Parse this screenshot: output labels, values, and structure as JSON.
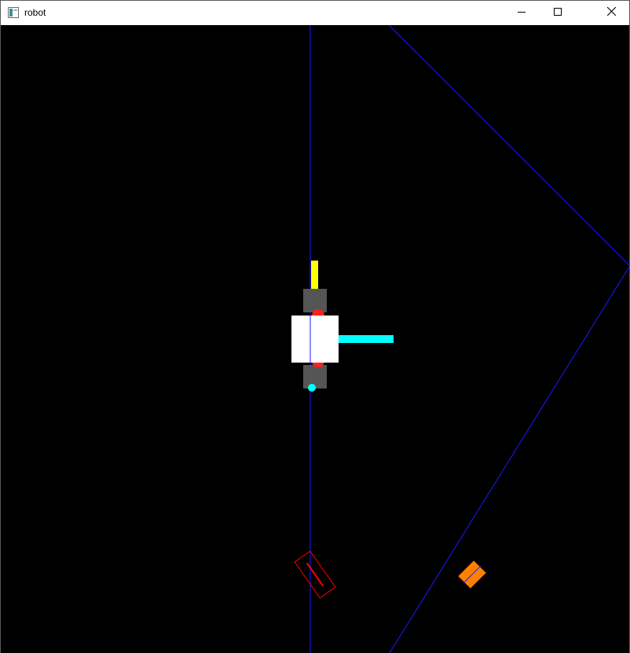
{
  "window": {
    "title": "robot",
    "icon": "app-window-icon",
    "controls": {
      "minimize_icon": "minimize-icon",
      "maximize_icon": "maximize-icon",
      "close_icon": "close-icon"
    }
  },
  "scene": {
    "background_color": "#000000",
    "guide_line_color": "#1a1aff",
    "robot": {
      "body_color": "#ffffff",
      "wheel_color": "#555555",
      "front_marker_color": "#ffff00",
      "side_arm_color": "#00ffff",
      "joint_color": "#ff2020"
    },
    "targets": {
      "outline_target_color": "#ff0000",
      "solid_target_color": "#ff8000"
    }
  }
}
